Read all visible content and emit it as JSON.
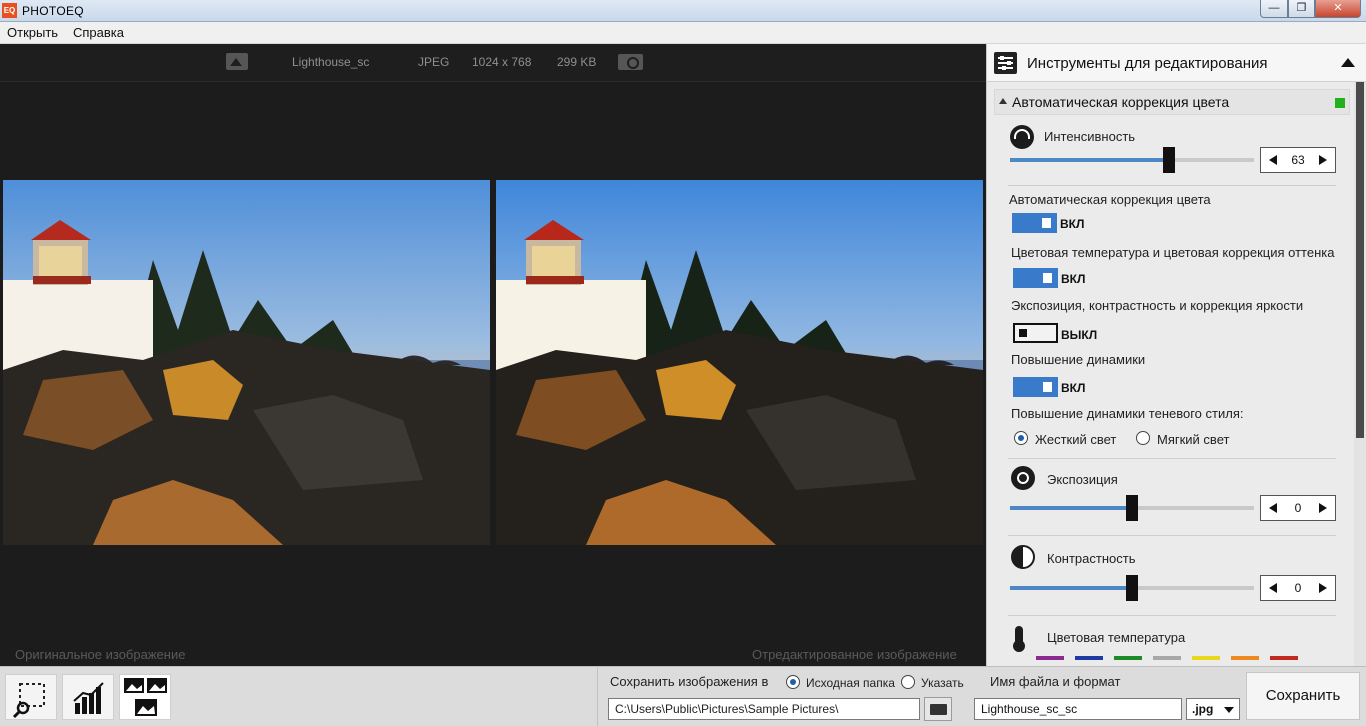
{
  "window": {
    "title": "PHOTOEQ",
    "logo": "EQ",
    "min": "—",
    "max": "❐",
    "close": "✕"
  },
  "menu": {
    "open": "Открыть",
    "help": "Справка"
  },
  "image_info": {
    "name": "Lighthouse_sc",
    "format": "JPEG",
    "dimensions": "1024 x 768",
    "size": "299 KB"
  },
  "captions": {
    "original": "Оригинальное изображение",
    "edited": "Отредактированное изображение"
  },
  "panel": {
    "title": "Инструменты для редактирования",
    "section": {
      "title": "Автоматическая коррекция цвета",
      "indicator_color": "#22b11d"
    },
    "intensity": {
      "label": "Интенсивность",
      "value": "63",
      "level_percent": 65
    },
    "toggles": [
      {
        "label": "Автоматическая коррекция цвета",
        "state": "ВКЛ",
        "on": true
      },
      {
        "label": "Цветовая температура и цветовая коррекция оттенка",
        "state": "ВКЛ",
        "on": true
      },
      {
        "label": "Экспозиция, контрастность  и коррекция яркости",
        "state": "ВЫКЛ",
        "on": false
      },
      {
        "label": "Повышение динамики",
        "state": "ВКЛ",
        "on": true
      }
    ],
    "shadow_style": {
      "label": "Повышение динамики теневого стиля:",
      "hard": "Жесткий свет",
      "soft": "Мягкий свет",
      "selected": "hard"
    },
    "exposure": {
      "label": "Экспозиция",
      "value": "0",
      "level_percent": 50
    },
    "contrast": {
      "label": "Контрастность",
      "value": "0",
      "level_percent": 50
    },
    "temperature": {
      "label": "Цветовая температура"
    },
    "swatch_colors": [
      "#8b2a8f",
      "#1f3aa0",
      "#1f8a2a",
      "#a8a8a8",
      "#e7d81c",
      "#ec8a1f",
      "#c22a1d"
    ]
  },
  "bottom": {
    "save_in_label": "Сохранить изображения в",
    "source_folder": "Исходная папка",
    "specify": "Указать",
    "path": "C:\\Users\\Public\\Pictures\\Sample Pictures\\",
    "filename_label": "Имя файла и формат",
    "filename": "Lighthouse_sc_sc",
    "format": ".jpg",
    "save_button": "Сохранить"
  }
}
